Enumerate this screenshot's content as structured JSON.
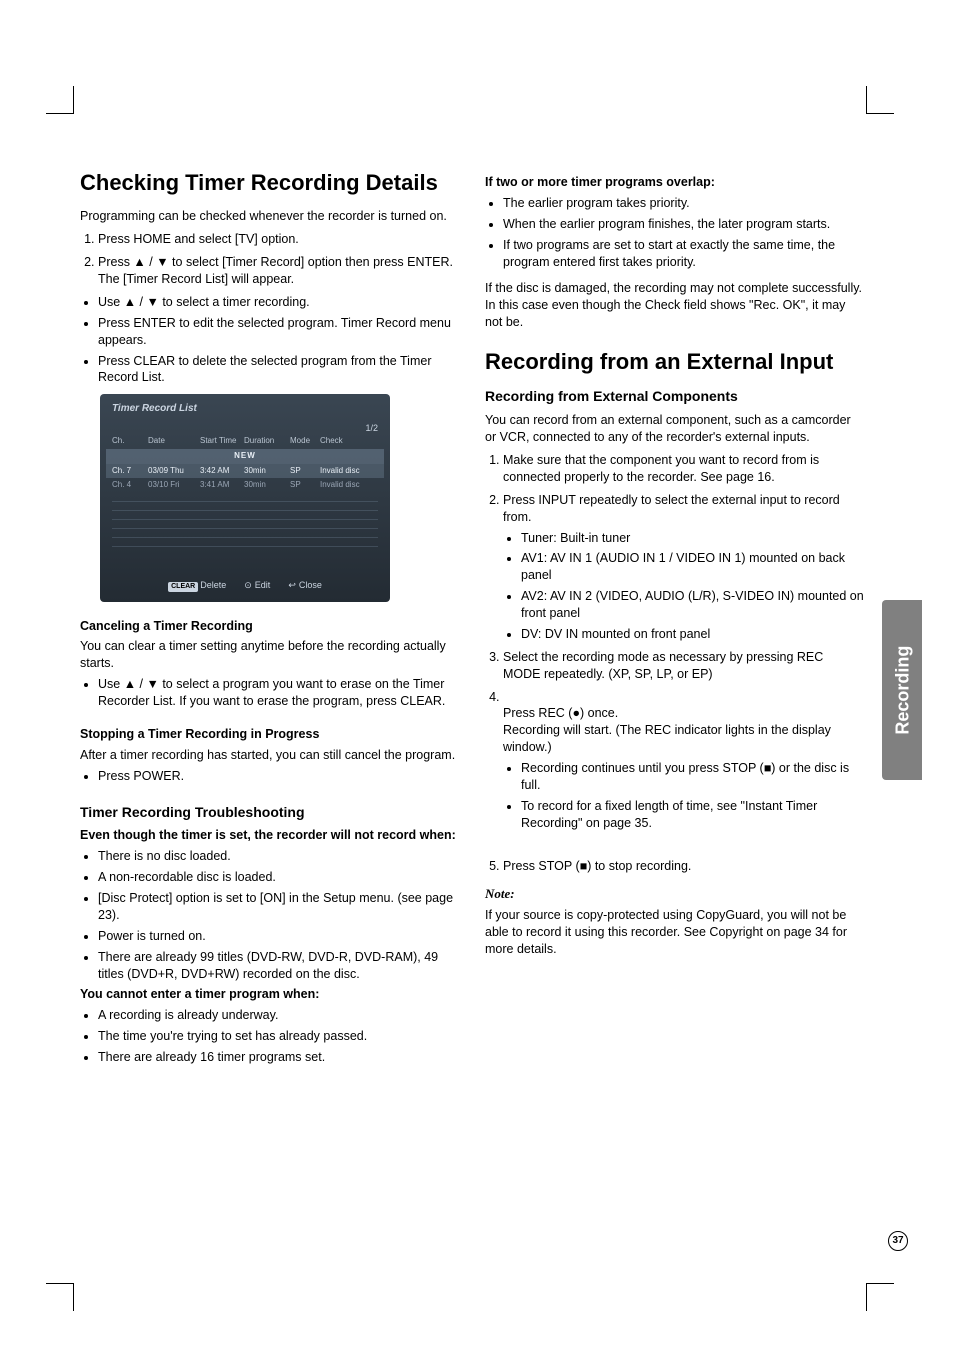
{
  "sideTab": "Recording",
  "pageNumber": "37",
  "left": {
    "h2": "Checking Timer Recording Details",
    "intro": "Programming can be checked whenever the recorder is turned on.",
    "steps": [
      "Press HOME and select [TV] option.",
      "Press ▲ / ▼ to select [Timer Record] option then press ENTER.\nThe [Timer Record List] will appear."
    ],
    "afterSteps": [
      "Use ▲ / ▼ to select a timer recording.",
      "Press ENTER to edit the selected program. Timer Record menu appears.",
      "Press CLEAR to delete the selected program from the Timer Record List."
    ],
    "uiShot": {
      "title": "Timer Record List",
      "pager": "1/2",
      "headers": [
        "Ch.",
        "Date",
        "Start Time",
        "Duration",
        "Mode",
        "Check"
      ],
      "newRow": "NEW",
      "rows": [
        {
          "ch": "Ch. 7",
          "date": "03/09 Thu",
          "start": "3:42 AM",
          "dur": "30min",
          "mode": "SP",
          "check": "Invalid disc",
          "hl": true
        },
        {
          "ch": "Ch. 4",
          "date": "03/10 Fri",
          "start": "3:41 AM",
          "dur": "30min",
          "mode": "SP",
          "check": "Invalid disc",
          "hl": false
        }
      ],
      "footer": {
        "deleteKey": "CLEAR",
        "delete": "Delete",
        "edit": "Edit",
        "close": "Close"
      }
    },
    "cancel": {
      "h4": "Canceling a Timer Recording",
      "p": "You can clear a timer setting anytime before the recording actually starts.",
      "bullets": [
        "Use ▲ / ▼ to select a program you want to erase on the Timer Recorder List. If you want to erase the program, press CLEAR."
      ]
    },
    "stop": {
      "h4": "Stopping a Timer Recording in Progress",
      "p": "After a timer recording has started, you can still cancel the program.",
      "bullets": [
        "Press POWER."
      ]
    },
    "trouble": {
      "h3": "Timer Recording Troubleshooting",
      "lead1": "Even though the timer is set, the recorder will not record when:",
      "list1": [
        "There is no disc loaded.",
        "A non-recordable disc is loaded.",
        "[Disc Protect] option is set to [ON] in the Setup menu. (see page 23).",
        "Power is turned on.",
        "There are already 99 titles (DVD-RW, DVD-R, DVD-RAM), 49 titles (DVD+R, DVD+RW) recorded on the disc."
      ],
      "lead2": "You cannot enter a timer program when:",
      "list2": [
        "A recording is already underway.",
        "The time you're trying to set has already passed.",
        "There are already 16 timer programs set."
      ]
    }
  },
  "right": {
    "overlap": {
      "h4": "If two or more timer programs overlap:",
      "bullets": [
        "The earlier program takes priority.",
        "When the earlier program finishes, the later program starts.",
        "If two programs are set to start at exactly the same time, the program entered first takes priority."
      ]
    },
    "damaged": "If the disc is damaged, the recording may not complete successfully. In this case even though the Check field shows \"Rec. OK\", it may not be.",
    "h2": "Recording from an External Input",
    "h3": "Recording from External Components",
    "intro": "You can record from an external component, such as a camcorder or VCR, connected to any of the recorder's external inputs.",
    "steps": {
      "s1": "Make sure that the component you want to record from is connected properly to the recorder. See page 16.",
      "s2": "Press INPUT repeatedly to select the external input to record from.",
      "s2list": [
        "Tuner: Built-in tuner",
        "AV1: AV IN 1 (AUDIO IN 1 / VIDEO IN 1) mounted on back panel",
        "AV2: AV IN 2 (VIDEO, AUDIO (L/R), S-VIDEO IN) mounted on front panel",
        "DV: DV IN mounted on front panel"
      ],
      "s3": "Select the recording mode as necessary by pressing REC MODE repeatedly. (XP, SP, LP, or EP)",
      "s4": "Press REC (●) once.\nRecording will start. (The REC indicator lights in the display window.)",
      "s4list": [
        "Recording continues until you press STOP (■) or the disc is full.",
        "To record for a fixed length of time, see \"Instant Timer Recording\" on page 35."
      ],
      "s5": "Press STOP (■) to stop recording."
    },
    "noteLabel": "Note:",
    "note": "If your source is copy-protected using CopyGuard, you will not be able to record it using this recorder. See Copyright on page 34 for more details."
  }
}
